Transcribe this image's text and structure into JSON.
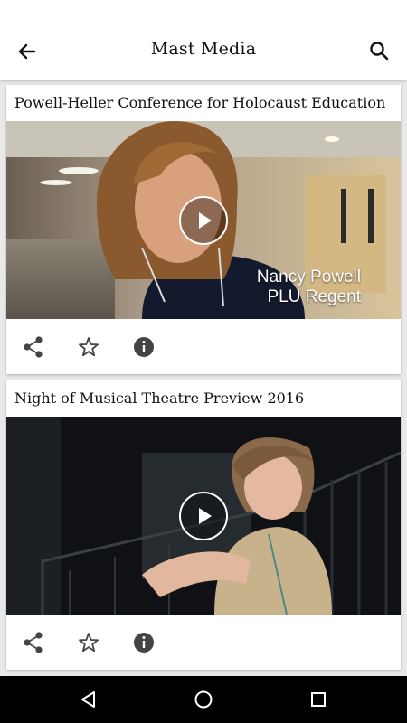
{
  "appbar": {
    "title": "Mast Media",
    "back_icon": "arrow-back-icon",
    "search_icon": "search-icon"
  },
  "videos": [
    {
      "title": "Powell-Heller Conference for Holocaust Education",
      "caption_line1": "Nancy Powell",
      "caption_line2": "PLU Regent"
    },
    {
      "title": "Night of Musical Theatre Preview 2016"
    }
  ],
  "actions": [
    "share-icon",
    "star-outline-icon",
    "info-icon"
  ],
  "navbar": [
    "back-triangle-icon",
    "home-circle-icon",
    "recents-square-icon"
  ],
  "colors": {
    "background": "#e9e9e9",
    "card": "#ffffff",
    "icon": "#444444",
    "navbar": "#000000"
  }
}
